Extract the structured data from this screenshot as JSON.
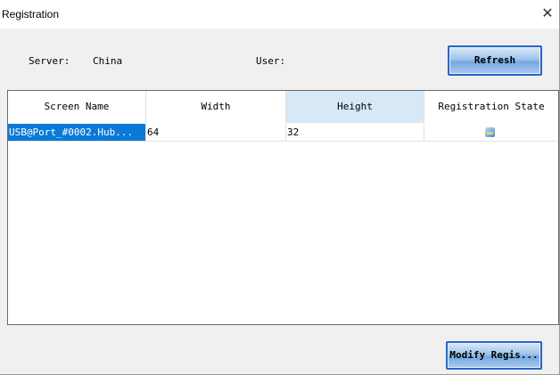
{
  "window": {
    "title": "Registration"
  },
  "info": {
    "server_label": "Server:",
    "server_value": "China",
    "user_label": "User:"
  },
  "buttons": {
    "refresh": "Refresh",
    "modify": "Modify Regis..."
  },
  "table": {
    "columns": [
      "Screen Name",
      "Width",
      "Height",
      "Registration State"
    ],
    "rows": [
      {
        "screen_name": "USB@Port_#0002.Hub...",
        "width": "64",
        "height": "32",
        "state_icon": "registration-state-icon"
      }
    ]
  },
  "colors": {
    "selection": "#0a7ad6",
    "header_active": "#d7e8f6",
    "button_border": "#2a64c8"
  }
}
